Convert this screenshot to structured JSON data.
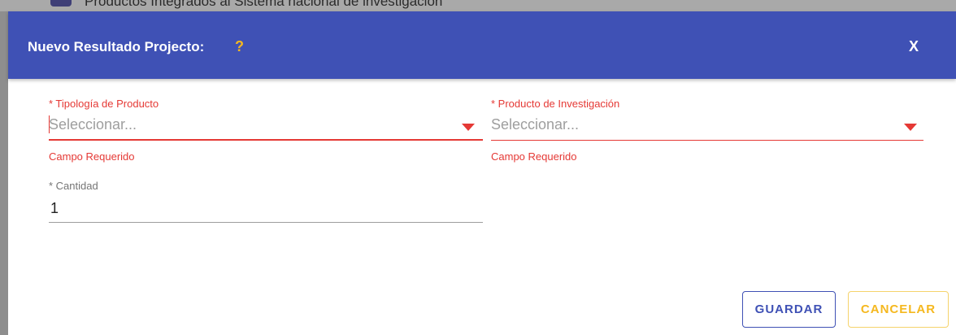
{
  "backdrop": {
    "text": "Productos Integrados al Sistema nacional de investigación"
  },
  "dialog": {
    "title": "Nuevo Resultado Projecto:",
    "help_mark": "?",
    "close_label": "X",
    "fields": {
      "tipologia": {
        "label": "* Tipología de Producto",
        "placeholder": "Seleccionar...",
        "error": "Campo Requerido"
      },
      "producto": {
        "label": "* Producto de Investigación",
        "placeholder": "Seleccionar...",
        "error": "Campo Requerido"
      },
      "cantidad": {
        "label": "* Cantidad",
        "value": "1"
      }
    },
    "buttons": {
      "save": "GUARDAR",
      "cancel": "CANCELAR"
    }
  },
  "colors": {
    "header": "#3f51b5",
    "error": "#e53935",
    "accent_yellow": "#f5b81f"
  }
}
